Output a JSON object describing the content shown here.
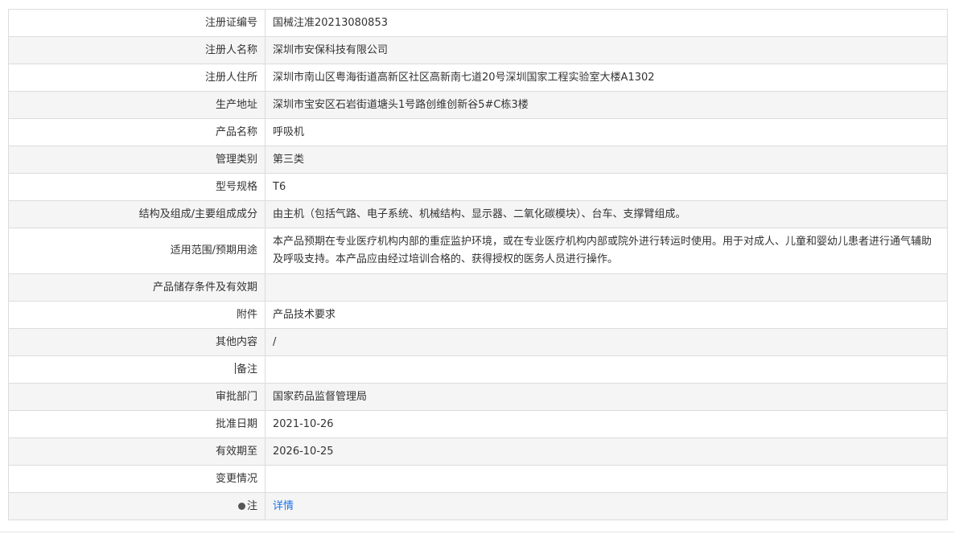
{
  "rows": [
    {
      "label": "注册证编号",
      "value": "国械注准20213080853"
    },
    {
      "label": "注册人名称",
      "value": "深圳市安保科技有限公司"
    },
    {
      "label": "注册人住所",
      "value": "深圳市南山区粤海街道高新区社区高新南七道20号深圳国家工程实验室大楼A1302"
    },
    {
      "label": "生产地址",
      "value": "深圳市宝安区石岩街道塘头1号路创维创新谷5#C栋3楼"
    },
    {
      "label": "产品名称",
      "value": "呼吸机"
    },
    {
      "label": "管理类别",
      "value": "第三类"
    },
    {
      "label": "型号规格",
      "value": "T6"
    },
    {
      "label": "结构及组成/主要组成成分",
      "value": "由主机（包括气路、电子系统、机械结构、显示器、二氧化碳模块）、台车、支撑臂组成。"
    },
    {
      "label": "适用范围/预期用途",
      "value": "本产品预期在专业医疗机构内部的重症监护环境，或在专业医疗机构内部或院外进行转运时使用。用于对成人、儿童和婴幼儿患者进行通气辅助及呼吸支持。本产品应由经过培训合格的、获得授权的医务人员进行操作。"
    },
    {
      "label": "产品储存条件及有效期",
      "value": ""
    },
    {
      "label": "附件",
      "value": "产品技术要求"
    },
    {
      "label": "其他内容",
      "value": "/"
    },
    {
      "label": "备注",
      "value": ""
    },
    {
      "label": "审批部门",
      "value": "国家药品监督管理局"
    },
    {
      "label": "批准日期",
      "value": "2021-10-26"
    },
    {
      "label": "有效期至",
      "value": "2026-10-25"
    },
    {
      "label": "变更情况",
      "value": ""
    },
    {
      "label": "注",
      "value": "详情"
    }
  ]
}
